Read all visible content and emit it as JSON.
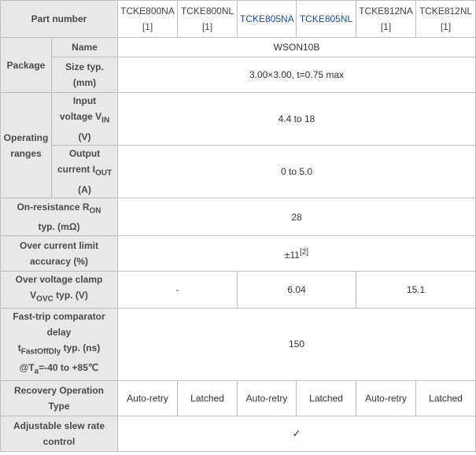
{
  "header": {
    "part_number_label": "Part number",
    "parts": [
      {
        "name": "TCKE800NA",
        "ref": "[1]"
      },
      {
        "name": "TCKE800NL",
        "ref": "[1]"
      },
      {
        "name": "TCKE805NA",
        "ref": ""
      },
      {
        "name": "TCKE805NL",
        "ref": ""
      },
      {
        "name": "TCKE812NA",
        "ref": "[1]"
      },
      {
        "name": "TCKE812NL",
        "ref": "[1]"
      }
    ]
  },
  "package": {
    "label": "Package",
    "name_label": "Name",
    "name_value": "WSON10B",
    "size_label": "Size typ.",
    "size_unit": "(mm)",
    "size_value": "3.00×3.00, t=0.75 max"
  },
  "operating_ranges": {
    "label_line1": "Operating",
    "label_line2": "ranges",
    "vin_line1": "Input",
    "vin_line2_prefix": "voltage  V",
    "vin_sub": "IN",
    "vin_unit": "(V)",
    "vin_value": "4.4 to 18",
    "iout_line1": "Output",
    "iout_line2_prefix": "current I",
    "iout_sub": "OUT",
    "iout_unit": "(A)",
    "iout_value": "0 to 5.0"
  },
  "on_resistance": {
    "line1_prefix": "On-resistance  R",
    "sub": "ON",
    "line2": "typ.  (mΩ)",
    "value": "28"
  },
  "over_current": {
    "line1": "Over current limit",
    "line2": "accuracy  (%)",
    "value": "±11",
    "value_ref": "[2]"
  },
  "over_voltage": {
    "line1": "Over voltage clamp",
    "line2_prefix": "V",
    "sub": "OVC",
    "line2_suffix": " typ.  (V)",
    "value_800": "-",
    "value_805": "6.04",
    "value_812": "15.1"
  },
  "fast_trip": {
    "line1": "Fast-trip comparator",
    "line2": "delay",
    "line3_prefix": "t",
    "sub": "FastOffDly",
    "line3_suffix": " typ.  (ns)",
    "line4_prefix": "@T",
    "sub2": "a",
    "line4_suffix": "=-40 to +85℃",
    "value": "150"
  },
  "recovery": {
    "line1": "Recovery Operation",
    "line2": "Type",
    "values": [
      "Auto-retry",
      "Latched",
      "Auto-retry",
      "Latched",
      "Auto-retry",
      "Latched"
    ]
  },
  "slew_rate": {
    "line1": "Adjustable slew rate",
    "line2": "control",
    "value": "✓"
  }
}
